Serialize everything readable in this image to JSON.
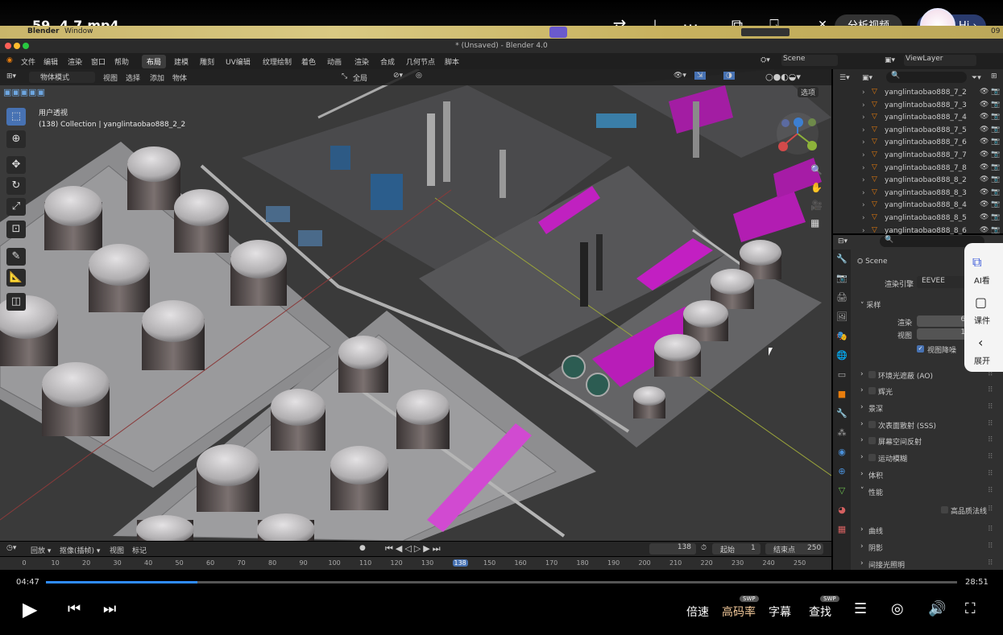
{
  "video": {
    "title": "59. 4.7.mp4",
    "analyze_label": "分析视频",
    "hi_label": "Hi",
    "current_time": "04:47",
    "total_time": "28:51",
    "progress": 0.166,
    "controls": {
      "speed": "倍速",
      "bitrate": "高码率",
      "bitrate_badge": "SWP",
      "subtitles": "字幕",
      "search": "查找",
      "search_badge": "SWP"
    }
  },
  "side_panel": {
    "ai_label": "AI看",
    "course_label": "课件",
    "expand_label": "展开"
  },
  "mac": {
    "app": "Blender",
    "window": "Window",
    "time": "09"
  },
  "blender": {
    "title": "* (Unsaved) - Blender 4.0",
    "menu": [
      "文件",
      "编辑",
      "渲染",
      "窗口",
      "帮助"
    ],
    "workspaces": [
      "布局",
      "建模",
      "雕刻",
      "UV编辑",
      "纹理绘制",
      "着色",
      "动画",
      "渲染",
      "合成",
      "几何节点",
      "脚本"
    ],
    "scene_label": "Scene",
    "view_layer_label": "ViewLayer",
    "viewport": {
      "mode": "物体模式",
      "menu": [
        "视图",
        "选择",
        "添加",
        "物体"
      ],
      "global": "全局",
      "options": "选项",
      "view_name": "用户透视",
      "collection_info": "(138) Collection | yanglintaobao888_2_2"
    },
    "outliner_items": [
      "yanglintaobao888_7_2",
      "yanglintaobao888_7_3",
      "yanglintaobao888_7_4",
      "yanglintaobao888_7_5",
      "yanglintaobao888_7_6",
      "yanglintaobao888_7_7",
      "yanglintaobao888_7_8",
      "yanglintaobao888_8_2",
      "yanglintaobao888_8_3",
      "yanglintaobao888_8_4",
      "yanglintaobao888_8_5",
      "yanglintaobao888_8_6"
    ],
    "properties": {
      "scene": "Scene",
      "render_engine_label": "渲染引擎",
      "render_engine": "EEVEE",
      "sampling": "采样",
      "render_label": "渲染",
      "render_value": "64",
      "viewport_label": "视图",
      "viewport_value": "16",
      "denoise": "视图降噪",
      "sections": [
        "环境光遮蔽 (AO)",
        "辉光",
        "景深",
        "次表面散射 (SSS)",
        "屏幕空间反射",
        "运动模糊",
        "体积",
        "性能",
        "高品质法线",
        "曲线",
        "阴影",
        "间接光照明"
      ]
    },
    "timeline": {
      "playback": "回放",
      "keying": "抠像(插帧)",
      "view": "视图",
      "marker": "标记",
      "current_frame": "138",
      "start_label": "起始",
      "start": "1",
      "end_label": "结束点",
      "end": "250",
      "ticks": [
        "0",
        "10",
        "20",
        "30",
        "40",
        "50",
        "60",
        "70",
        "80",
        "90",
        "100",
        "110",
        "120",
        "130",
        "138",
        "150",
        "160",
        "170",
        "180",
        "190",
        "200",
        "210",
        "220",
        "230",
        "240",
        "250"
      ]
    }
  }
}
